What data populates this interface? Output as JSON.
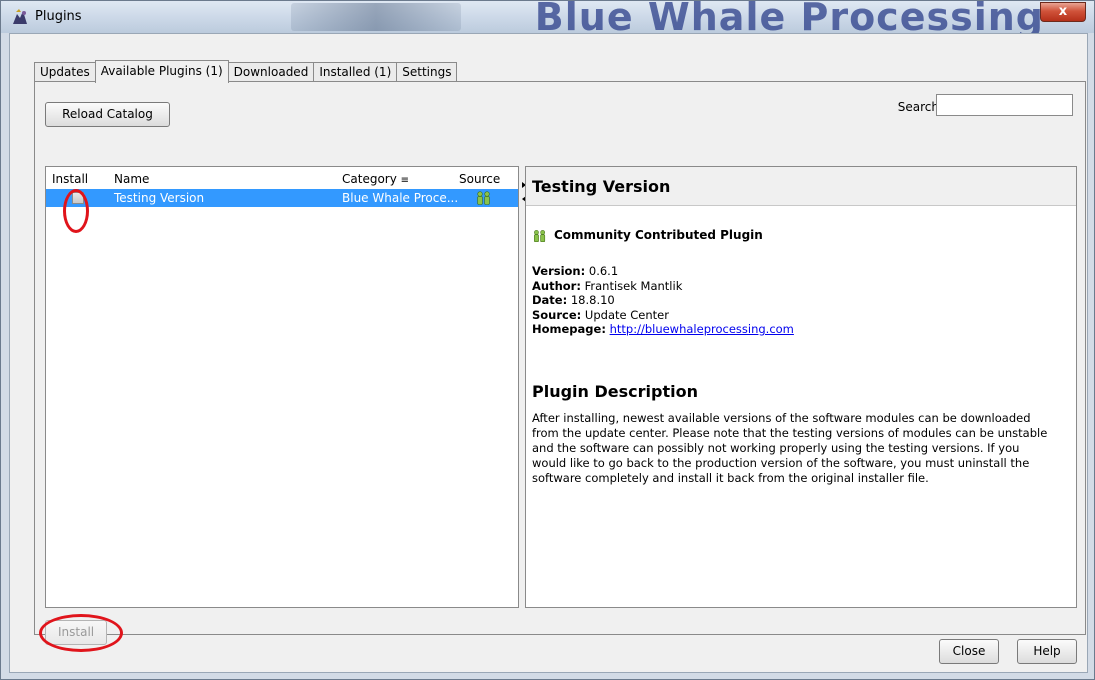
{
  "window": {
    "title": "Plugins",
    "watermark": "Blue Whale Processing",
    "close_glyph": "x"
  },
  "tabs": [
    {
      "label": "Updates",
      "active": false
    },
    {
      "label": "Available Plugins (1)",
      "active": true
    },
    {
      "label": "Downloaded",
      "active": false
    },
    {
      "label": "Installed (1)",
      "active": false
    },
    {
      "label": "Settings",
      "active": false
    }
  ],
  "toolbar": {
    "reload_label": "Reload Catalog",
    "search_label": "Search:",
    "search_value": ""
  },
  "table": {
    "columns": [
      "Install",
      "Name",
      "Category",
      "Source"
    ],
    "sort_indicator": "≡",
    "rows": [
      {
        "install": false,
        "name": "Testing Version",
        "category": "Blue Whale Proce...",
        "source_icon": "community-icon",
        "selected": true
      }
    ]
  },
  "detail": {
    "title": "Testing Version",
    "contributed_label": "Community Contributed Plugin",
    "fields": [
      {
        "label": "Version:",
        "value": "0.6.1"
      },
      {
        "label": "Author:",
        "value": "Frantisek Mantlik"
      },
      {
        "label": "Date:",
        "value": "18.8.10"
      },
      {
        "label": "Source:",
        "value": "Update Center"
      },
      {
        "label": "Homepage:",
        "value": "http://bluewhaleprocessing.com"
      }
    ],
    "description_title": "Plugin Description",
    "description_lines": [
      "After installing, newest available versions of the software modules can be downloaded",
      "from the update center. Please note that the testing versions of modules can be unstable",
      "and the software can possibly not working properly using the testing versions. If you",
      "would like to go back to the production version of the software, you must uninstall the",
      "software completely and install it back from the original installer file."
    ]
  },
  "footer": {
    "install_label": "Install",
    "close_label": "Close",
    "help_label": "Help"
  },
  "colors": {
    "selection": "#3399ff",
    "annotation": "#e0141b",
    "link": "#0000ee"
  }
}
